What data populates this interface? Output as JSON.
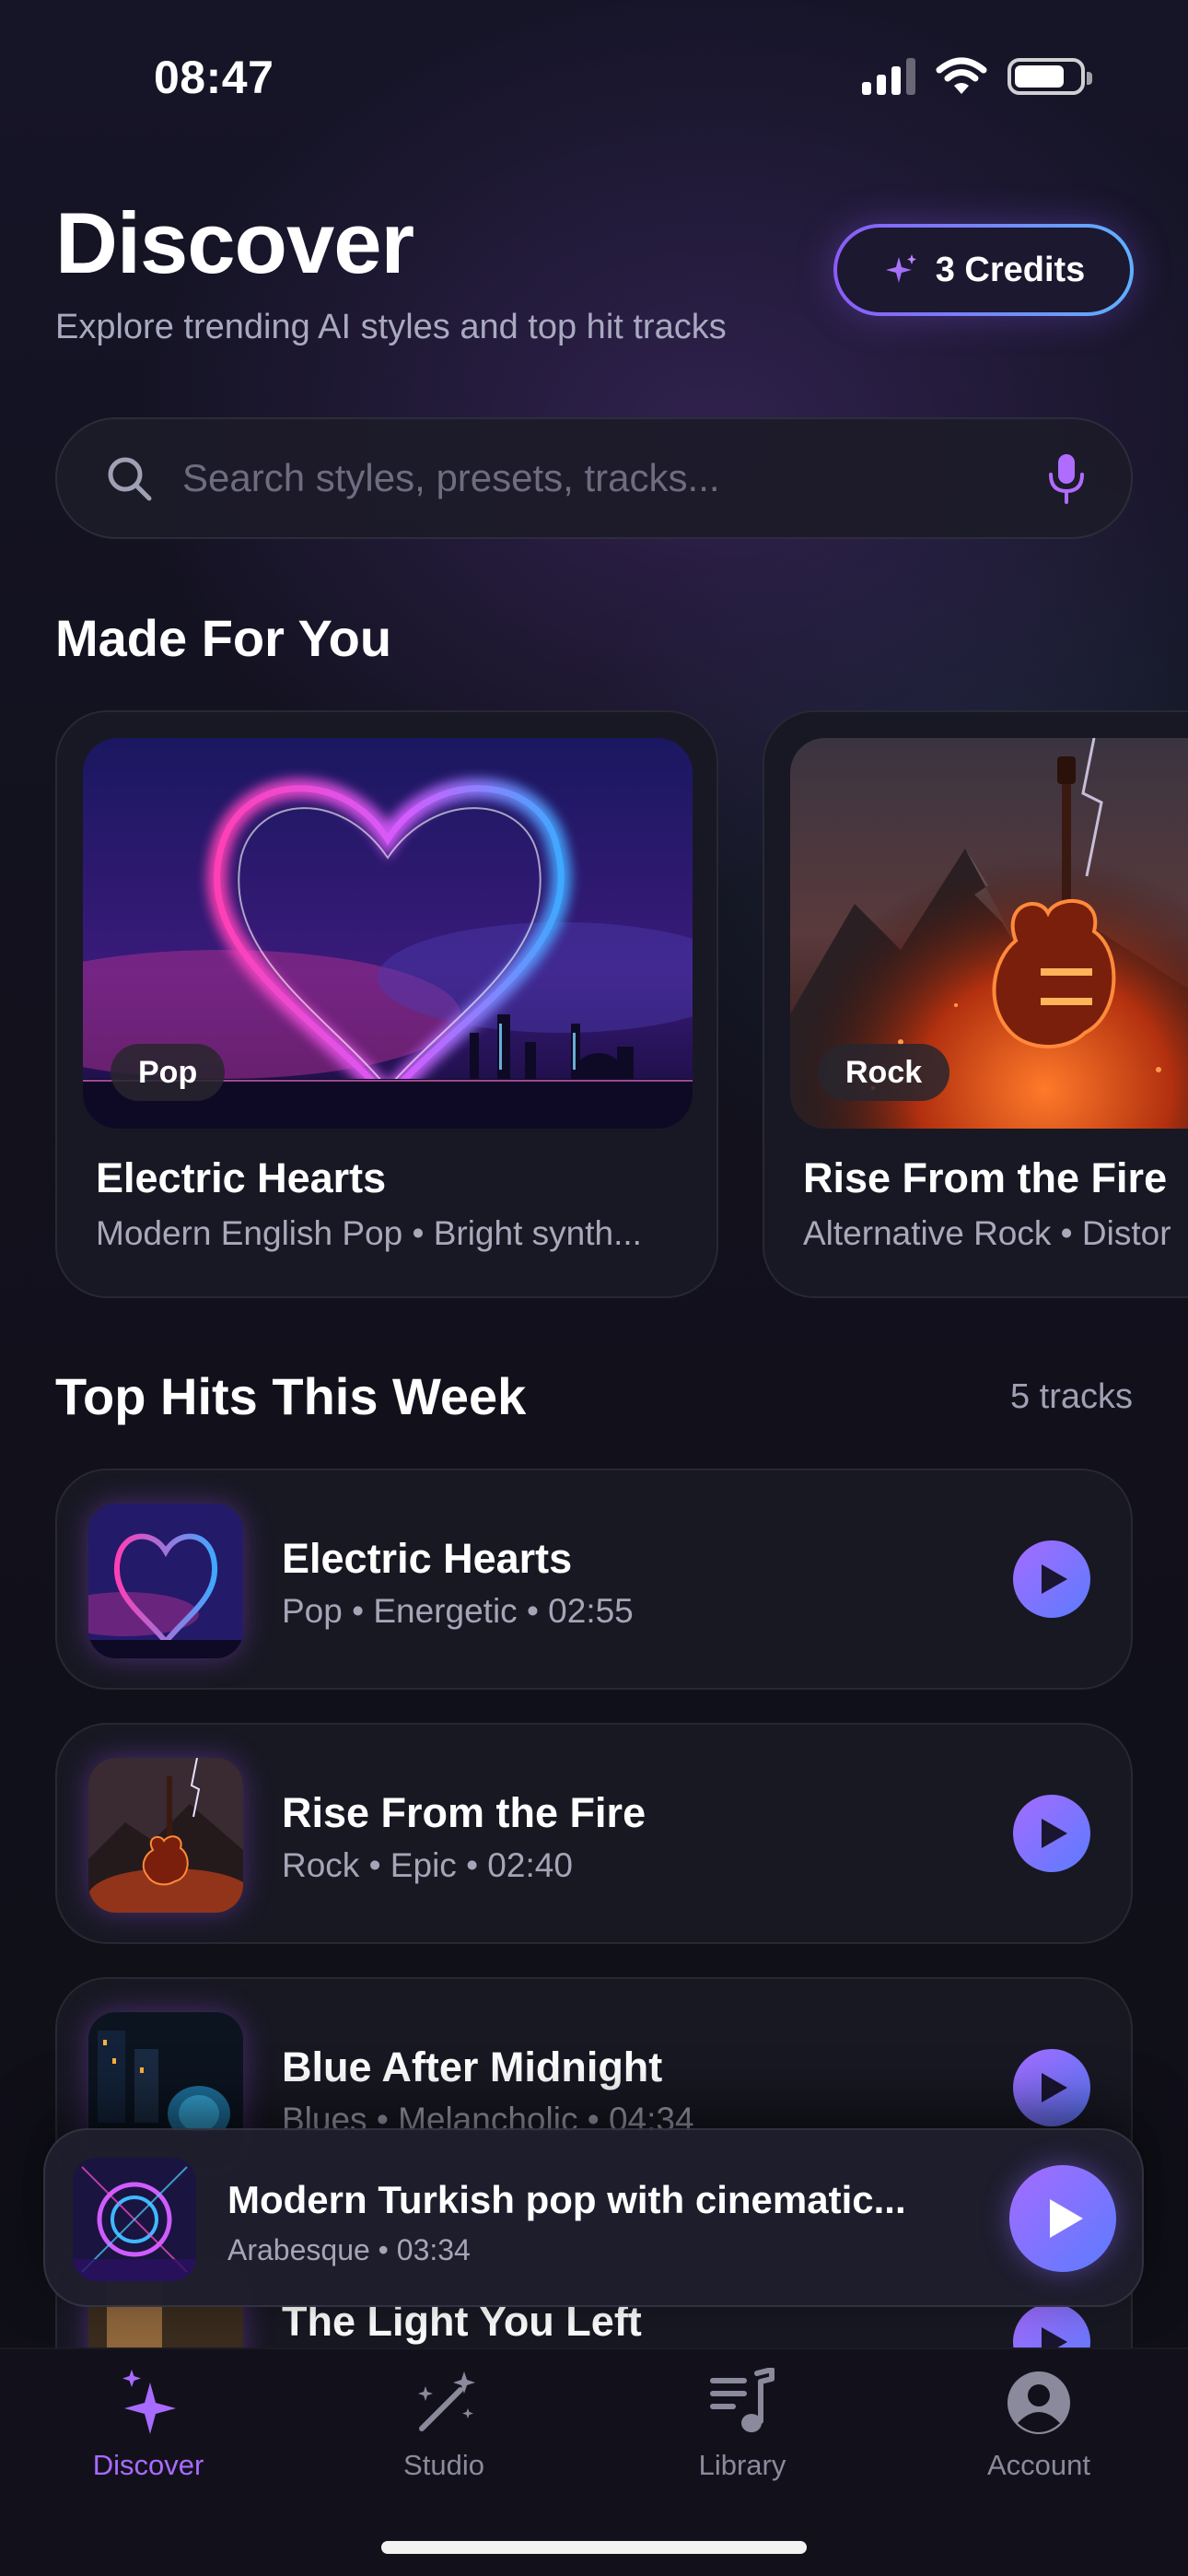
{
  "status_bar": {
    "time": "08:47"
  },
  "header": {
    "title": "Discover",
    "subtitle": "Explore trending AI styles and top hit tracks",
    "credits_label": "3 Credits"
  },
  "search": {
    "placeholder": "Search styles, presets, tracks..."
  },
  "made_for_you": {
    "title": "Made For You",
    "cards": [
      {
        "genre": "Pop",
        "title": "Electric Hearts",
        "subtitle": "Modern English Pop • Bright synth..."
      },
      {
        "genre": "Rock",
        "title": "Rise From the Fire",
        "subtitle": "Alternative Rock • Distor"
      }
    ]
  },
  "top_hits": {
    "title": "Top Hits This Week",
    "count": "5 tracks",
    "tracks": [
      {
        "title": "Electric Hearts",
        "meta": "Pop • Energetic • 02:55"
      },
      {
        "title": "Rise From the Fire",
        "meta": "Rock • Epic • 02:40"
      },
      {
        "title": "Blue After Midnight",
        "meta": "Blues • Melancholic • 04:34"
      },
      {
        "title": "The Light You Left",
        "meta": ""
      }
    ]
  },
  "mini_player": {
    "title": "Modern Turkish pop with cinematic...",
    "meta": "Arabesque • 03:34"
  },
  "tabbar": {
    "tabs": [
      {
        "label": "Discover",
        "icon": "sparkles-icon",
        "active": true
      },
      {
        "label": "Studio",
        "icon": "magic-wand-icon",
        "active": false
      },
      {
        "label": "Library",
        "icon": "music-library-icon",
        "active": false
      },
      {
        "label": "Account",
        "icon": "user-circle-icon",
        "active": false
      }
    ]
  },
  "colors": {
    "accent": "#a86bff",
    "accent_blue": "#5b7cff",
    "background": "#0f0f17"
  }
}
